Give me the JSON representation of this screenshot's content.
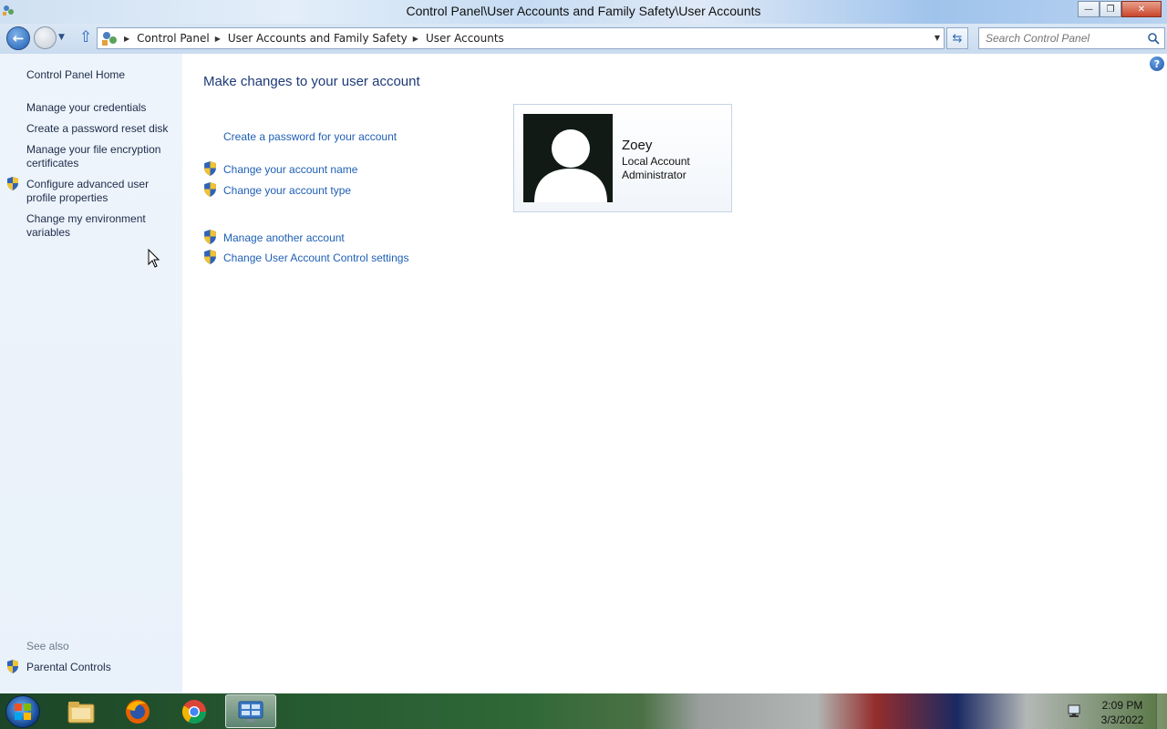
{
  "window": {
    "title": "Control Panel\\User Accounts and Family Safety\\User Accounts",
    "minimize": "—",
    "restore": "❐",
    "close": "✕"
  },
  "address_bar": {
    "breadcrumbs": [
      "Control Panel",
      "User Accounts and Family Safety",
      "User Accounts"
    ],
    "search_placeholder": "Search Control Panel"
  },
  "left_pane": {
    "home": "Control Panel Home",
    "links": [
      "Manage your credentials",
      "Create a password reset disk",
      "Manage your file encryption certificates",
      "Configure advanced user profile properties",
      "Change my environment variables"
    ],
    "see_also_label": "See also",
    "see_also": [
      "Parental Controls"
    ]
  },
  "main": {
    "heading": "Make changes to your user account",
    "tasks": [
      "Create a password for your account",
      "Change your account name",
      "Change your account type",
      "Manage another account",
      "Change User Account Control settings"
    ],
    "help": "?"
  },
  "account": {
    "name": "Zoey",
    "type": "Local Account",
    "role": "Administrator"
  },
  "taskbar": {
    "time": "2:09 PM",
    "date": "3/3/2022"
  },
  "colors": {
    "link": "#1f5fb5",
    "heading": "#1e3a78",
    "left_pane_bg": "#eef4fb"
  }
}
